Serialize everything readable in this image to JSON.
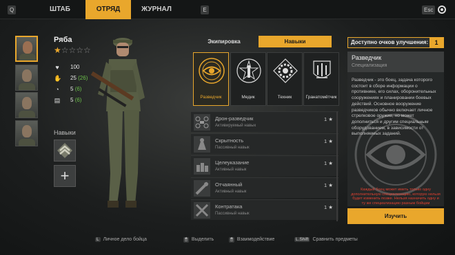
{
  "topbar": {
    "left_key": "Q",
    "right_key": "E",
    "tabs": [
      {
        "label": "ШТАБ",
        "active": false
      },
      {
        "label": "ОТРЯД",
        "active": true
      },
      {
        "label": "ЖУРНАЛ",
        "active": false
      }
    ],
    "esc_label": "Esc",
    "settings_icon": "gear-icon"
  },
  "squad": {
    "portraits": [
      {
        "selected": true
      },
      {
        "selected": false
      },
      {
        "selected": false
      },
      {
        "selected": false
      }
    ]
  },
  "soldier": {
    "name": "Ряба",
    "rank_stars": 1,
    "max_stars": 5,
    "stats": [
      {
        "icon": "health-icon",
        "glyph": "♥",
        "value": "100",
        "bonus": ""
      },
      {
        "icon": "stamina-icon",
        "glyph": "✋",
        "value": "25",
        "bonus": "(26)"
      },
      {
        "icon": "speed-icon",
        "glyph": "◔",
        "value": "5",
        "bonus": "(6)"
      },
      {
        "icon": "capacity-icon",
        "glyph": "▤",
        "value": "5",
        "bonus": "(6)"
      }
    ],
    "skills_label": "Навыки"
  },
  "subtabs": {
    "equipment": "Экипировка",
    "skills": "Навыки",
    "active": "skills"
  },
  "specializations": [
    {
      "label": "Разведчик",
      "icon": "eye-icon",
      "active": true
    },
    {
      "label": "Медик",
      "icon": "medic-icon",
      "active": false
    },
    {
      "label": "Техник",
      "icon": "gear-technician-icon",
      "active": false
    },
    {
      "label": "Гранатомётчик",
      "icon": "grenadier-icon",
      "active": false
    }
  ],
  "skills": [
    {
      "name": "Дрон-разведчик",
      "type": "Активируемый навык",
      "cost": "1",
      "icon": "drone-icon"
    },
    {
      "name": "Скрытность",
      "type": "Пассивный навык",
      "cost": "1",
      "icon": "stealth-icon"
    },
    {
      "name": "Целеуказание",
      "type": "Активный навык",
      "cost": "1",
      "icon": "target-icon"
    },
    {
      "name": "Отчаянный",
      "type": "Активный навык",
      "cost": "1",
      "icon": "desperate-icon"
    },
    {
      "name": "Контратака",
      "type": "Пассивный навык",
      "cost": "1",
      "icon": "counterattack-icon"
    }
  ],
  "info": {
    "points_label": "Доступно очков улучшения:",
    "points_value": "1",
    "title": "Разведчик",
    "subtitle": "Специализация",
    "description": "Разведчик - это боец, задача которого состоит в сборе информации о противнике, его силах, оборонительных сооружениях и планировании боевых действий. Основное вооружение разведчиков обычно включает личное стрелковое оружие, но может дополниться и другим специальным оборудованием, в зависимости от выполняемых заданий.",
    "warning": "Каждый боец может иметь только одну дополнительную специализацию, которую нельзя будет изменить позже. Нельзя назначить одну и ту же специализацию разным бойцам",
    "learn_button": "Изучить"
  },
  "hints": [
    {
      "key": "L",
      "label": "Личное дело бойца"
    },
    {
      "key": "🖱",
      "label": "Выделить"
    },
    {
      "key": "🖱",
      "label": "Взаимодействие"
    },
    {
      "key": "L.Shift",
      "label": "Сравнить предметы"
    }
  ],
  "colors": {
    "accent": "#e9a72c",
    "bonus": "#6cc04a",
    "warning": "#e04030"
  }
}
